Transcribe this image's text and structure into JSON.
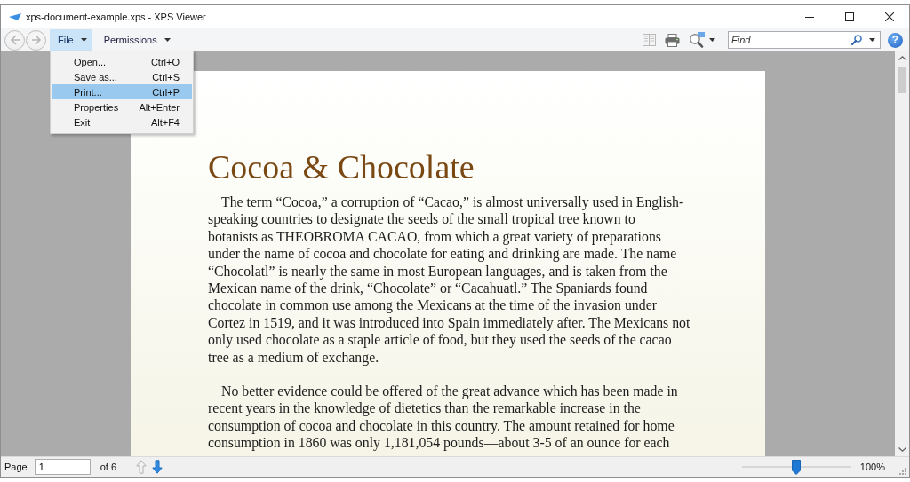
{
  "window": {
    "title": "xps-document-example.xps - XPS Viewer"
  },
  "navigation": [
    {
      "kind": "back",
      "disabled": true
    },
    {
      "kind": "forward",
      "disabled": true
    }
  ],
  "menu_bar": [
    {
      "label": "File",
      "expanded": true,
      "items": [
        {
          "label": "Open...",
          "shortcut": "Ctrl+O",
          "selected": false
        },
        {
          "label": "Save as...",
          "shortcut": "Ctrl+S",
          "selected": false
        },
        {
          "label": "Print...",
          "shortcut": "Ctrl+P",
          "selected": true
        },
        {
          "label": "Properties",
          "shortcut": "Alt+Enter",
          "selected": false
        },
        {
          "label": "Exit",
          "shortcut": "Alt+F4",
          "selected": false
        }
      ]
    },
    {
      "label": "Permissions",
      "expanded": false
    }
  ],
  "search": {
    "placeholder": "Find"
  },
  "help": {
    "label": "?"
  },
  "document": {
    "title": "Cocoa & Chocolate",
    "paragraphs": [
      "The term “Cocoa,” a corruption of “Cacao,” is almost universally used in English-\nspeaking countries to designate the seeds of the small tropical tree known to\nbotanists as THEOBROMA CACAO, from which a great variety of preparations\nunder the name of cocoa and chocolate for eating and drinking are made. The name\n“Chocolatl” is nearly the same in most European languages, and is taken from the\nMexican name of the drink, “Chocolate” or “Cacahuatl.” The Spaniards found\nchocolate in common use among the Mexicans at the time of the invasion under\nCortez in 1519, and it was introduced into Spain immediately after. The Mexicans not\nonly used chocolate as a staple article of food, but they used the seeds of the cacao\ntree as a medium of exchange.",
      "No better evidence could be offered of the great advance which has been made in\nrecent years in the knowledge of dietetics than the remarkable increase in the\nconsumption of cocoa and chocolate in this country. The amount retained for home\nconsumption in 1860 was only 1,181,054 pounds—about 3-5 of an ounce for each"
    ]
  },
  "status_bar": {
    "page_label": "Page",
    "page_number": "1",
    "page_count": "of 6",
    "page_buttons": [
      {
        "kind": "previous",
        "disabled": true
      },
      {
        "kind": "next",
        "disabled": false
      }
    ],
    "zoom": {
      "level": 0.5,
      "reading": "100%"
    }
  }
}
